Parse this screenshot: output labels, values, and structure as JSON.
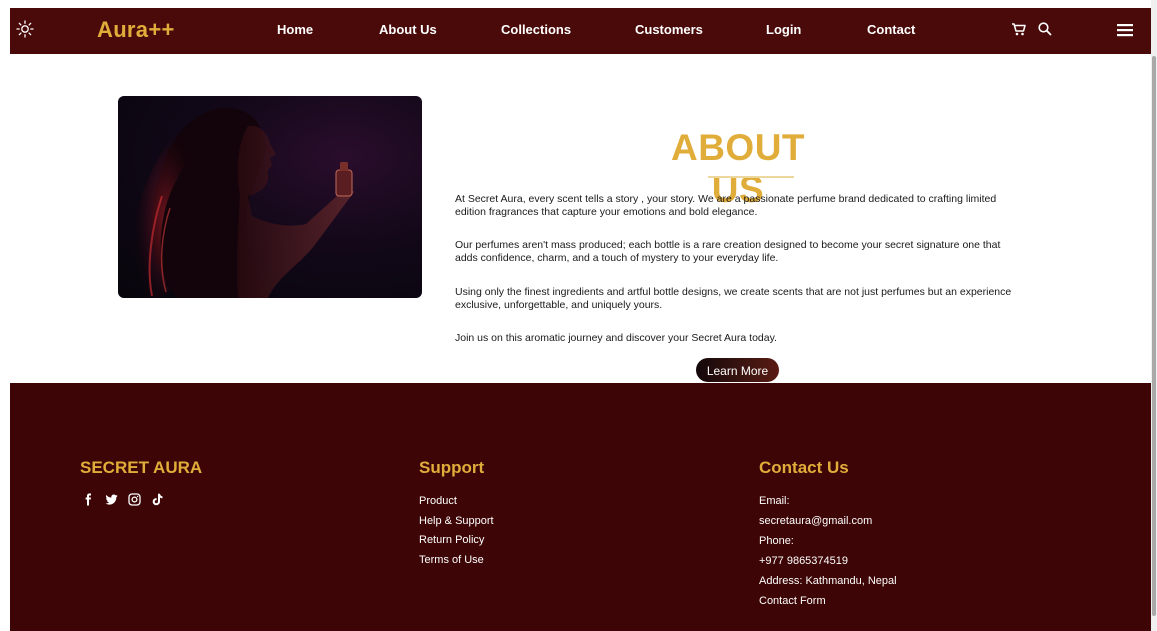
{
  "nav": {
    "brand": "Aura++",
    "links": [
      "Home",
      "About Us",
      "Collections",
      "Customers",
      "Login",
      "Contact"
    ]
  },
  "icons": {
    "theme": "sun-icon",
    "cart": "cart-icon",
    "search": "search-icon",
    "menu": "hamburger-menu-icon",
    "social": [
      "facebook-icon",
      "twitter-icon",
      "instagram-icon",
      "tiktok-icon"
    ]
  },
  "about": {
    "title": "ABOUT US",
    "paragraphs": [
      "At Secret Aura, every scent tells a story , your story. We are a passionate perfume brand dedicated to crafting limited edition fragrances that capture your emotions and bold elegance.",
      "Our perfumes aren't mass produced; each bottle is a rare creation designed to become your secret signature one that adds confidence, charm, and a touch of mystery to your everyday life.",
      "Using only the finest ingredients and artful bottle designs, we create scents that are not just perfumes but an experience exclusive, unforgettable, and uniquely yours.",
      "Join us on this aromatic journey and discover your Secret Aura today."
    ],
    "button": "Learn More"
  },
  "footer": {
    "brand": "SECRET AURA",
    "support": {
      "heading": "Support",
      "links": [
        "Product",
        "Help & Support",
        "Return Policy",
        "Terms of Use"
      ]
    },
    "contact": {
      "heading": "Contact Us",
      "lines": [
        "Email:",
        "secretaura@gmail.com",
        "Phone:",
        "+977 9865374519",
        "Address: Kathmandu, Nepal",
        "Contact Form"
      ]
    }
  },
  "colors": {
    "nav_bg": "#4a0a0a",
    "footer_bg": "#3d0505",
    "accent_gold": "#e1ad3a"
  }
}
